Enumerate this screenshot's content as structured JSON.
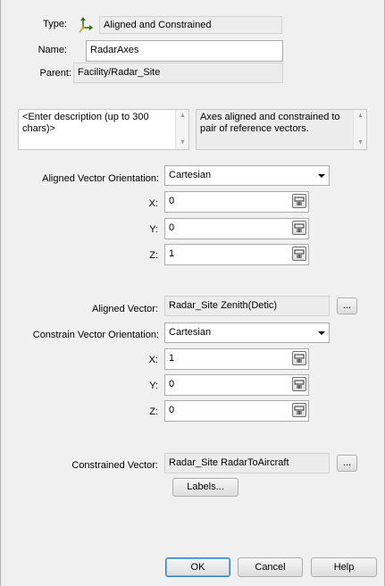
{
  "header": {
    "type_label": "Type:",
    "type_value": "Aligned and Constrained",
    "name_label": "Name:",
    "name_value": "RadarAxes",
    "parent_label": "Parent:",
    "parent_value": "Facility/Radar_Site"
  },
  "description": {
    "placeholder": "<Enter description (up to 300 chars)>",
    "info": "Axes aligned and constrained to pair of reference vectors."
  },
  "aligned": {
    "orientation_label": "Aligned Vector Orientation:",
    "orientation_value": "Cartesian",
    "x_label": "X:",
    "x_value": "0",
    "y_label": "Y:",
    "y_value": "0",
    "z_label": "Z:",
    "z_value": "1",
    "vector_label": "Aligned Vector:",
    "vector_value": "Radar_Site Zenith(Detic)",
    "browse_label": "..."
  },
  "constrained": {
    "orientation_label": "Constrain Vector Orientation:",
    "orientation_value": "Cartesian",
    "x_label": "X:",
    "x_value": "1",
    "y_label": "Y:",
    "y_value": "0",
    "z_label": "Z:",
    "z_value": "0",
    "vector_label": "Constrained Vector:",
    "vector_value": "Radar_Site RadarToAircraft",
    "browse_label": "...",
    "labels_button": "Labels..."
  },
  "footer": {
    "ok": "OK",
    "cancel": "Cancel",
    "help": "Help"
  }
}
